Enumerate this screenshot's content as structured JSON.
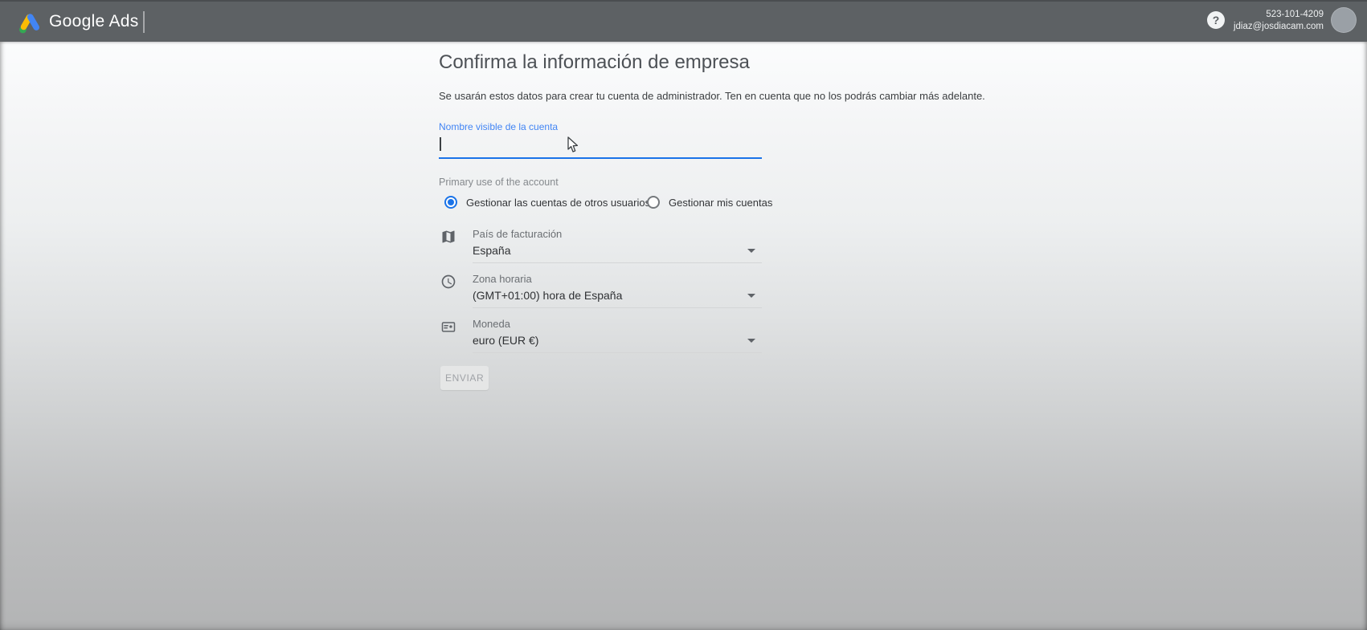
{
  "header": {
    "brand": "Google Ads",
    "help_label": "?",
    "phone": "523-101-4209",
    "email": "jdiaz@josdiacam.com"
  },
  "form": {
    "title": "Confirma la información de empresa",
    "subtitle": "Se usarán estos datos para crear tu cuenta de administrador. Ten en cuenta que no los podrás cambiar más adelante.",
    "account_name": {
      "label": "Nombre visible de la cuenta",
      "value": "",
      "placeholder": ""
    },
    "primary_use": {
      "label": "Primary use of the account",
      "options": [
        {
          "label": "Gestionar las cuentas de otros usuarios",
          "selected": true
        },
        {
          "label": "Gestionar mis cuentas",
          "selected": false
        }
      ]
    },
    "fields": [
      {
        "icon": "map-icon",
        "label": "País de facturación",
        "value": "España"
      },
      {
        "icon": "clock-icon",
        "label": "Zona horaria",
        "value": "(GMT+01:00) hora de España"
      },
      {
        "icon": "card-icon",
        "label": "Moneda",
        "value": "euro (EUR €)"
      }
    ],
    "submit_label": "ENVIAR"
  },
  "colors": {
    "header_bg": "#5d6164",
    "accent_blue": "#1a73e8",
    "label_blue": "#4285f4",
    "logo_yellow": "#fbbc04",
    "logo_blue": "#4285f4",
    "logo_green": "#34a853",
    "avatar_gray": "#9aa0a6"
  }
}
